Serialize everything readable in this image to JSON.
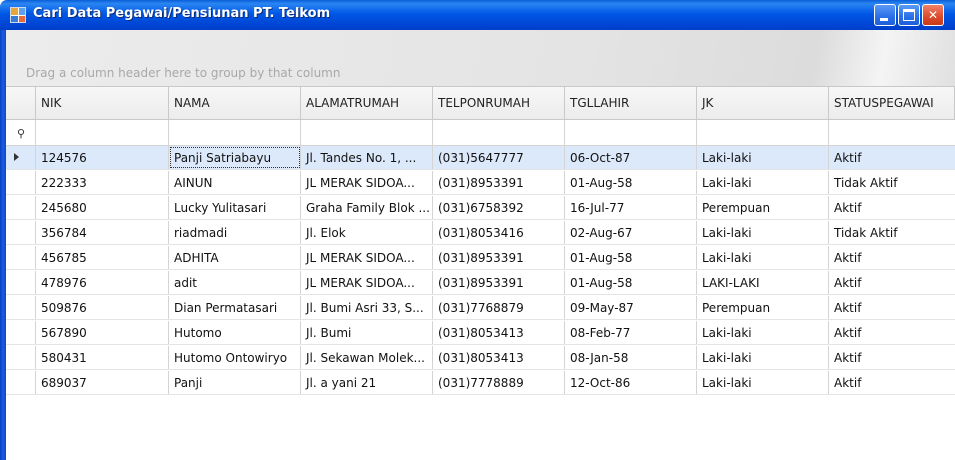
{
  "window": {
    "title": "Cari Data Pegawai/Pensiunan PT. Telkom",
    "controls": {
      "minimize_icon": "minimize-icon",
      "maximize_icon": "maximize-icon",
      "close_glyph": "✕"
    }
  },
  "group_panel": {
    "hint": "Drag a column header here to group by that column"
  },
  "grid": {
    "columns": [
      "NIK",
      "NAMA",
      "ALAMATRUMAH",
      "TELPONRUMAH",
      "TGLLAHIR",
      "JK",
      "STATUSPEGAWAI"
    ],
    "filter_icon": "filter-row-icon",
    "selected_row": 0,
    "rows": [
      [
        "124576",
        "Panji Satriabayu",
        "Jl. Tandes No. 1, ...",
        "(031)5647777",
        "06-Oct-87",
        "Laki-laki",
        "Aktif"
      ],
      [
        "222333",
        "AINUN",
        "JL MERAK SIDOA...",
        "(031)8953391",
        "01-Aug-58",
        "Laki-laki",
        "Tidak Aktif"
      ],
      [
        "245680",
        "Lucky Yulitasari",
        "Graha Family Blok ...",
        "(031)6758392",
        "16-Jul-77",
        "Perempuan",
        "Aktif"
      ],
      [
        "356784",
        "riadmadi",
        "Jl. Elok",
        "(031)8053416",
        "02-Aug-67",
        "Laki-laki",
        "Tidak Aktif"
      ],
      [
        "456785",
        "ADHITA",
        "JL MERAK SIDOA...",
        "(031)8953391",
        "01-Aug-58",
        "Laki-laki",
        "Aktif"
      ],
      [
        "478976",
        "adit",
        "JL MERAK SIDOA...",
        "(031)8953391",
        "01-Aug-58",
        "LAKI-LAKI",
        "Aktif"
      ],
      [
        "509876",
        "Dian Permatasari",
        "Jl. Bumi Asri 33, S...",
        "(031)7768879",
        "09-May-87",
        "Perempuan",
        "Aktif"
      ],
      [
        "567890",
        "Hutomo",
        "Jl. Bumi",
        "(031)8053413",
        "08-Feb-77",
        "Laki-laki",
        "Aktif"
      ],
      [
        "580431",
        "Hutomo Ontowiryo",
        "Jl. Sekawan Molek...",
        "(031)8053413",
        "08-Jan-58",
        "Laki-laki",
        "Aktif"
      ],
      [
        "689037",
        "Panji",
        "Jl. a yani 21",
        "(031)7778889",
        "12-Oct-86",
        "Laki-laki",
        "Aktif"
      ]
    ]
  }
}
